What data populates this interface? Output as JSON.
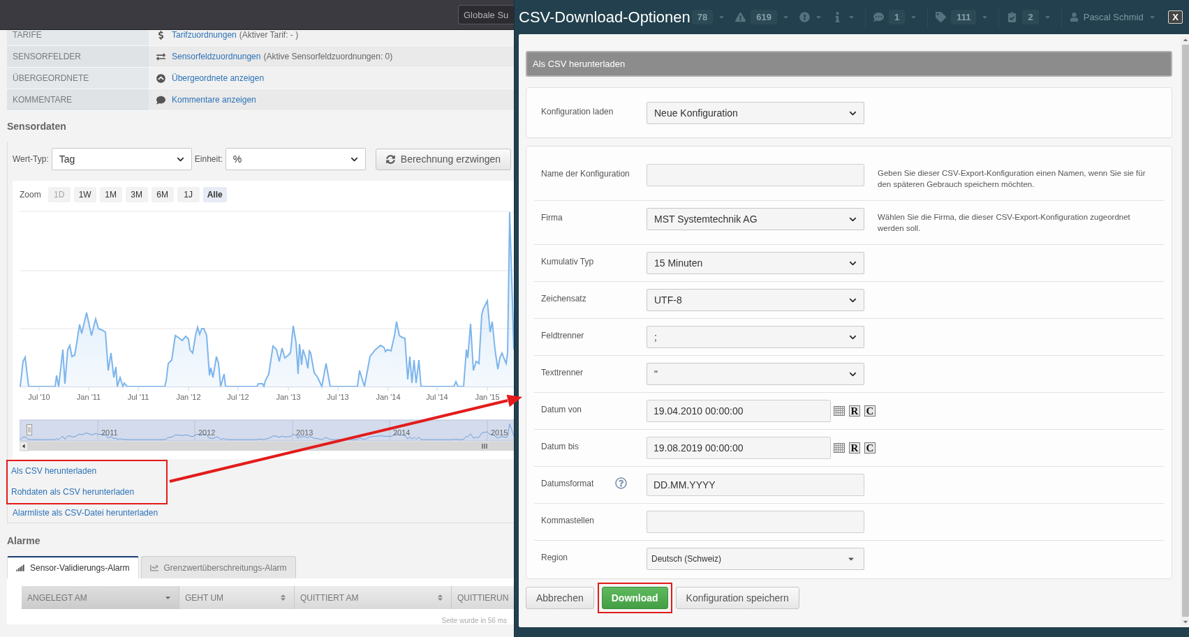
{
  "top_bar": {
    "search": {
      "placeholder": "Globale Su"
    }
  },
  "info_rows": [
    {
      "kind": "tariff",
      "label": "TARIFE",
      "link": "Tarifzuordnungen",
      "note": "(Aktiver Tarif: - )"
    },
    {
      "kind": "fields",
      "label": "SENSORFELDER",
      "link": "Sensorfeldzuordnungen",
      "note": "(Aktive Sensorfeldzuordnungen: 0)"
    },
    {
      "kind": "parents",
      "label": "ÜBERGEORDNETE",
      "link": "Übergeordnete anzeigen"
    },
    {
      "kind": "comments",
      "label": "KOMMENTARE",
      "link": "Kommentare anzeigen"
    }
  ],
  "sensor_data": {
    "title": "Sensordaten",
    "filters": [
      {
        "label": "Wert-Typ:",
        "value": "Tag"
      },
      {
        "label": "Einheit:",
        "value": "%"
      }
    ],
    "recalc_button": "Berechnung erzwingen",
    "chart": {
      "zoom_label": "Zoom",
      "zoom_buttons": [
        {
          "label": "1D",
          "disabled": true,
          "selected": false
        },
        {
          "label": "1W",
          "disabled": false,
          "selected": false
        },
        {
          "label": "1M",
          "disabled": false,
          "selected": false
        },
        {
          "label": "3M",
          "disabled": false,
          "selected": false
        },
        {
          "label": "6M",
          "disabled": false,
          "selected": false
        },
        {
          "label": "1J",
          "disabled": false,
          "selected": false
        },
        {
          "label": "Alle",
          "disabled": false,
          "selected": true
        }
      ],
      "x_labels": [
        "Jul '10",
        "Jan '11",
        "Jul '11",
        "Jan '12",
        "Jul '12",
        "Jan '13",
        "Jul '13",
        "Jan '14",
        "Jul '14",
        "Jan '15"
      ],
      "navigator_labels": [
        "2011",
        "2012",
        "2013",
        "2014",
        "2015"
      ]
    },
    "download_links": [
      {
        "label": "Als CSV herunterladen",
        "highlighted": true
      },
      {
        "label": "Rohdaten als CSV herunterladen",
        "highlighted": true
      },
      {
        "label": "Alarmliste als CSV-Datei herunterladen",
        "highlighted": false
      }
    ]
  },
  "alarms": {
    "title": "Alarme",
    "tabs": [
      {
        "kind": "validation",
        "label": "Sensor-Validierungs-Alarm",
        "selected": true
      },
      {
        "kind": "threshold",
        "label": "Grenzwertüberschreitungs-Alarm",
        "selected": false
      }
    ],
    "columns": [
      {
        "label": "ANGELEGT AM",
        "sorted": true
      },
      {
        "label": "GEHT UM",
        "sorted": false
      },
      {
        "label": "QUITTIERT AM",
        "sorted": false
      },
      {
        "label": "QUITTIERUN",
        "sorted": false
      }
    ],
    "footer_note": "Seite wurde in 56 ms"
  },
  "dialog": {
    "title": "CSV-Download-Optionen",
    "background_nav": {
      "items": [
        {
          "kind": "count",
          "badge": "78"
        },
        {
          "kind": "warning",
          "badge": "619"
        },
        {
          "kind": "error"
        },
        {
          "kind": "info"
        },
        {
          "kind": "message",
          "badge": "1"
        },
        {
          "kind": "tag",
          "badge": "111"
        },
        {
          "kind": "task",
          "badge": "2"
        }
      ],
      "user": "Pascal Schmid"
    },
    "close_label": "X",
    "section_title": "Als CSV herunterladen",
    "load_config": {
      "label": "Konfiguration laden",
      "value": "Neue Konfiguration"
    },
    "fields": [
      {
        "kind": "text",
        "label": "Name der Konfiguration",
        "help": "Geben Sie dieser CSV-Export-Konfiguration einen Namen, wenn Sie sie für den späteren Gebrauch speichern möchten."
      },
      {
        "kind": "select",
        "label": "Firma",
        "value": "MST Systemtechnik AG",
        "help": "Wählen Sie die Firma, die dieser CSV-Export-Konfiguration zugeordnet werden soll."
      },
      {
        "kind": "select",
        "label": "Kumulativ Typ",
        "value": "15 Minuten"
      },
      {
        "kind": "select",
        "label": "Zeichensatz",
        "value": "UTF-8"
      },
      {
        "kind": "select",
        "label": "Feldtrenner",
        "value": ";"
      },
      {
        "kind": "select",
        "label": "Texttrenner",
        "value": "\""
      },
      {
        "kind": "date",
        "label": "Datum von",
        "value": "19.04.2010 00:00:00",
        "actions": [
          "R",
          "C"
        ]
      },
      {
        "kind": "date",
        "label": "Datum bis",
        "value": "19.08.2019 00:00:00",
        "actions": [
          "R",
          "C"
        ]
      },
      {
        "kind": "text",
        "label": "Datumsformat",
        "value": "DD.MM.YYYY",
        "help_icon": true
      },
      {
        "kind": "text",
        "label": "Kommastellen"
      },
      {
        "kind": "combo",
        "label": "Region",
        "value": "Deutsch (Schweiz)"
      }
    ],
    "buttons": [
      {
        "kind": "default",
        "label": "Abbrechen",
        "highlighted": false
      },
      {
        "kind": "primary",
        "label": "Download",
        "highlighted": true
      },
      {
        "kind": "default",
        "label": "Konfiguration speichern",
        "highlighted": false
      }
    ]
  }
}
